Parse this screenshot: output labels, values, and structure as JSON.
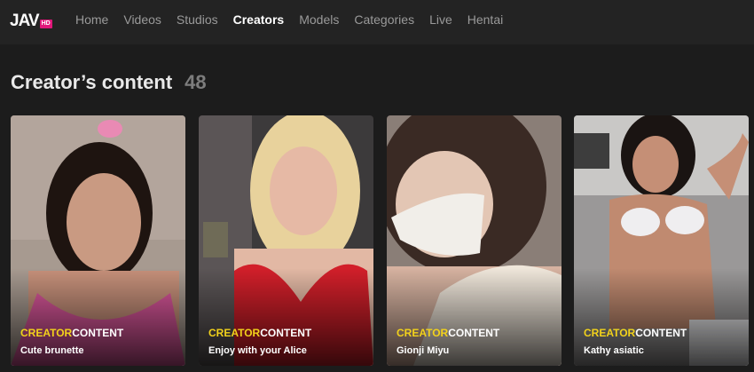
{
  "logo": {
    "text": "JAV",
    "badge": "HD"
  },
  "nav": [
    {
      "label": "Home",
      "active": false
    },
    {
      "label": "Videos",
      "active": false
    },
    {
      "label": "Studios",
      "active": false
    },
    {
      "label": "Creators",
      "active": true
    },
    {
      "label": "Models",
      "active": false
    },
    {
      "label": "Categories",
      "active": false
    },
    {
      "label": "Live",
      "active": false
    },
    {
      "label": "Hentai",
      "active": false
    }
  ],
  "heading": {
    "title": "Creator’s content",
    "count": "48"
  },
  "cards": [
    {
      "brand_a": "CREATOR",
      "brand_b": "CONTENT",
      "caption": "Cute brunette"
    },
    {
      "brand_a": "CREATOR",
      "brand_b": "CONTENT",
      "caption": "Enjoy with your Alice"
    },
    {
      "brand_a": "CREATOR",
      "brand_b": "CONTENT",
      "caption": "Gionji Miyu"
    },
    {
      "brand_a": "CREATOR",
      "brand_b": "CONTENT",
      "caption": "Kathy asiatic"
    }
  ],
  "colors": {
    "accent_yellow": "#f2d21b",
    "logo_badge": "#e0177a",
    "background": "#1c1c1c"
  }
}
